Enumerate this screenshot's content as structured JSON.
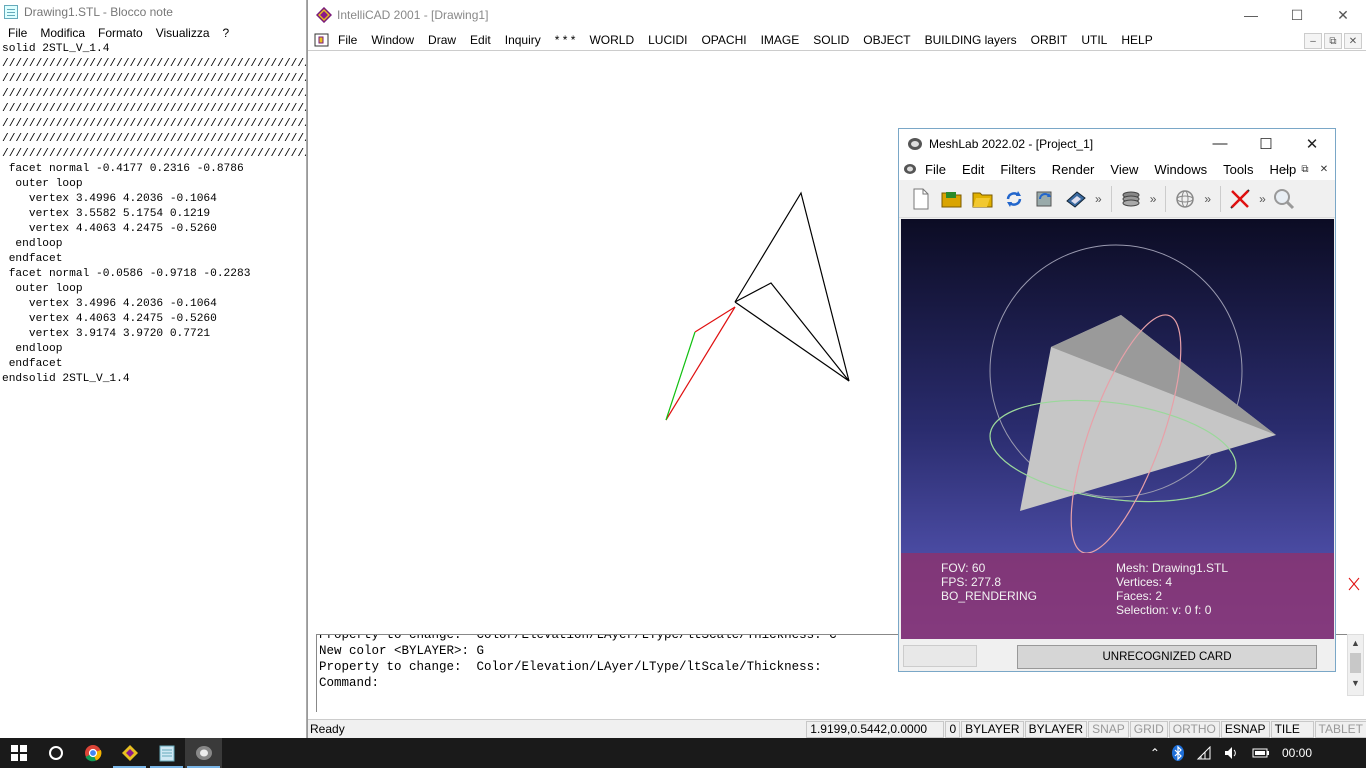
{
  "notepad": {
    "title": "Drawing1.STL - Blocco note",
    "menu": [
      "File",
      "Modifica",
      "Formato",
      "Visualizza",
      "?"
    ],
    "lines": [
      "solid 2STL_V_1.4",
      "//////////////////////////////////////////////",
      "//////////////////////////////////////////////",
      "//////////////////////////////////////////////",
      "//////////////////////////////////////////////",
      "//////////////////////////////////////////////",
      "//////////////////////////////////////////////",
      "//////////////////////////////////////////////",
      " facet normal -0.4177 0.2316 -0.8786",
      "  outer loop",
      "    vertex 3.4996 4.2036 -0.1064",
      "    vertex 3.5582 5.1754 0.1219",
      "    vertex 4.4063 4.2475 -0.5260",
      "  endloop",
      " endfacet",
      " facet normal -0.0586 -0.9718 -0.2283",
      "  outer loop",
      "    vertex 3.4996 4.2036 -0.1064",
      "    vertex 4.4063 4.2475 -0.5260",
      "    vertex 3.9174 3.9720 0.7721",
      "  endloop",
      " endfacet",
      "endsolid 2STL_V_1.4"
    ]
  },
  "intellicad": {
    "title": "IntelliCAD 2001 - [Drawing1]",
    "menu": [
      "File",
      "Window",
      "Draw",
      "Edit",
      "Inquiry",
      "* * *",
      "WORLD",
      "LUCIDI",
      "OPACHI",
      "IMAGE",
      "SOLID",
      "OBJECT",
      "BUILDING layers",
      "ORBIT",
      "UTIL",
      "HELP"
    ],
    "command_lines": [
      "Property to change:  Color/Elevation/LAyer/LType/ltScale/Thickness: C",
      "New color <BYLAYER>: G",
      "Property to change:  Color/Elevation/LAyer/LType/ltScale/Thickness:",
      "",
      "Command:"
    ],
    "status": {
      "ready": "Ready",
      "coords": "1.9199,0.5442,0.0000",
      "layer": "0",
      "color": "BYLAYER",
      "linetype": "BYLAYER",
      "snap": "SNAP",
      "grid": "GRID",
      "ortho": "ORTHO",
      "esnap": "ESNAP",
      "tile": "TILE",
      "tablet": "TABLET"
    },
    "colors": {
      "line_black": "#000000",
      "line_red": "#e01010",
      "line_green": "#10c010"
    }
  },
  "meshlab": {
    "title": "MeshLab 2022.02 - [Project_1]",
    "menu": [
      "File",
      "Edit",
      "Filters",
      "Render",
      "View",
      "Windows",
      "Tools",
      "Help"
    ],
    "toolbar_icons": [
      "new-project-icon",
      "open-project-icon",
      "import-mesh-icon",
      "reload-icon",
      "reload-all-icon",
      "save-snapshot-icon",
      "layers-icon",
      "trackball-icon",
      "measure-icon",
      "zoom-icon"
    ],
    "info": {
      "fov": "FOV: 60",
      "fps": "FPS:   277.8",
      "rendering": "BO_RENDERING",
      "mesh": "Mesh: Drawing1.STL",
      "vertices": "Vertices: 4",
      "faces": "Faces: 2",
      "selection": "Selection: v: 0 f: 0"
    },
    "card": "UNRECOGNIZED CARD"
  },
  "taskbar": {
    "time": "00:00",
    "apps": [
      "start-icon",
      "search-circle-icon",
      "chrome-icon",
      "intellicad-icon",
      "notepad-icon",
      "meshlab-icon"
    ]
  }
}
